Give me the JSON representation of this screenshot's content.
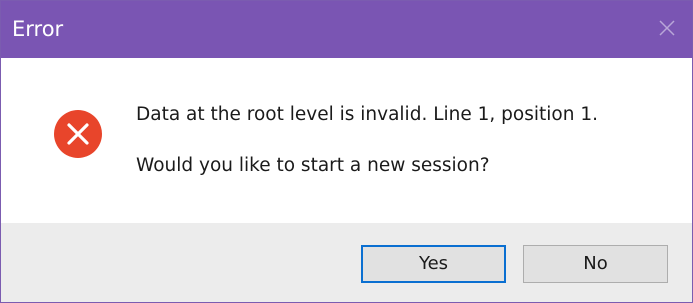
{
  "dialog": {
    "title": "Error",
    "close_icon": "close-icon",
    "icon": "error-icon",
    "message_line1": "Data at the root level is invalid. Line 1, position 1.",
    "message_line2": "Would you like to start a new session?",
    "buttons": {
      "yes_label": "Yes",
      "no_label": "No"
    }
  },
  "colors": {
    "titlebar": "#7a55b3",
    "error_icon": "#e8452b",
    "focus_border": "#0a6fd1",
    "footer": "#ececec"
  }
}
